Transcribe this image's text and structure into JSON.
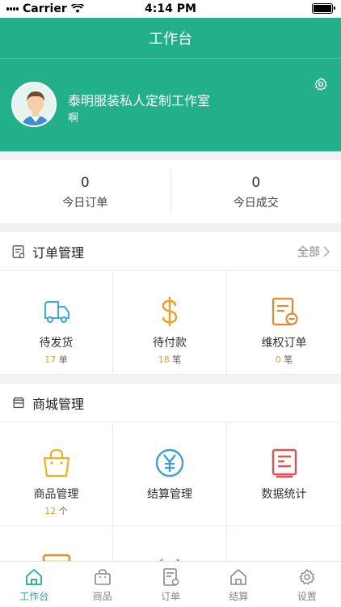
{
  "status_bar": {
    "carrier": "Carrier",
    "time": "4:14 PM"
  },
  "header": {
    "title": "工作台"
  },
  "profile": {
    "shop_name": "泰明服装私人定制工作室",
    "subtitle": "啊"
  },
  "stats": [
    {
      "value": "0",
      "label": "今日订单"
    },
    {
      "value": "0",
      "label": "今日成交"
    }
  ],
  "order_section": {
    "title": "订单管理",
    "more": "全部",
    "items": [
      {
        "label": "待发货",
        "count": "17",
        "unit": "单",
        "icon": "truck-icon",
        "color": "#4aa8e0"
      },
      {
        "label": "待付款",
        "count": "18",
        "unit": "笔",
        "icon": "dollar-icon",
        "color": "#f0a020"
      },
      {
        "label": "维权订单",
        "count": "0",
        "unit": "笔",
        "icon": "dispute-doc-icon",
        "color": "#e8892a"
      }
    ]
  },
  "mall_section": {
    "title": "商城管理",
    "items": [
      {
        "label": "商品管理",
        "count": "12",
        "unit": "个",
        "icon": "shopping-bag-icon",
        "color": "#f0b020"
      },
      {
        "label": "结算管理",
        "icon": "yen-circle-icon",
        "color": "#3aa0d8"
      },
      {
        "label": "数据统计",
        "icon": "data-panel-icon",
        "color": "#e85050"
      }
    ]
  },
  "tabbar": [
    {
      "label": "工作台",
      "icon": "home-icon",
      "active": true
    },
    {
      "label": "商品",
      "icon": "bag-icon",
      "active": false
    },
    {
      "label": "订单",
      "icon": "order-doc-icon",
      "active": false
    },
    {
      "label": "结算",
      "icon": "house-icon",
      "active": false
    },
    {
      "label": "设置",
      "icon": "gear-icon",
      "active": false
    }
  ],
  "colors": {
    "brand": "#21b089",
    "count": "#f0a020"
  }
}
